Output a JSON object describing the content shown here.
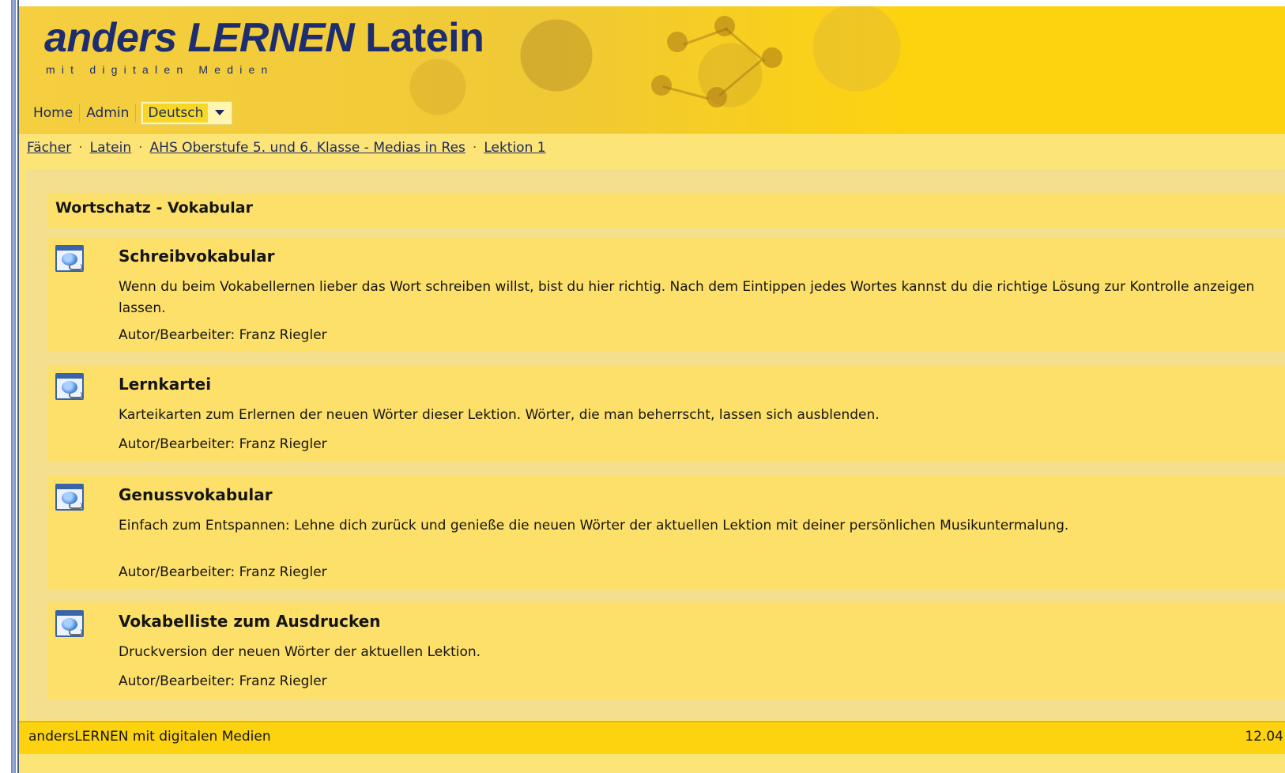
{
  "header": {
    "logo_part1": "anders",
    "logo_part2": "LERNEN",
    "logo_part3": "Latein",
    "subtitle": "mit digitalen Medien"
  },
  "nav": {
    "home": "Home",
    "admin": "Admin",
    "language": "Deutsch"
  },
  "breadcrumb": [
    "Fächer",
    "Latein",
    "AHS Oberstufe 5. und 6. Klasse - Medias in Res",
    "Lektion 1"
  ],
  "breadcrumb_separator": "·",
  "section": {
    "title": "Wortschatz - Vokabular"
  },
  "items": [
    {
      "title": "Schreibvokabular",
      "desc": "Wenn du beim Vokabellernen lieber das Wort schreiben willst, bist du hier richtig. Nach dem Eintippen jedes Wortes kannst du die richtige Lösung zur Kontrolle anzeigen lassen.",
      "author": "Autor/Bearbeiter: Franz Riegler"
    },
    {
      "title": "Lernkartei",
      "desc": "Karteikarten zum Erlernen der neuen Wörter dieser Lektion. Wörter, die man beherrscht, lassen sich ausblenden.",
      "author": "Autor/Bearbeiter: Franz Riegler"
    },
    {
      "title": "Genussvokabular",
      "desc": "Einfach zum Entspannen: Lehne dich zurück und genieße die neuen Wörter der aktuellen Lektion mit deiner persönlichen Musikuntermalung.",
      "author": "Autor/Bearbeiter: Franz Riegler"
    },
    {
      "title": "Vokabelliste zum Ausdrucken",
      "desc": "Druckversion der neuen Wörter der aktuellen Lektion.",
      "author": "Autor/Bearbeiter: Franz Riegler"
    }
  ],
  "footer": {
    "left": "andersLERNEN mit digitalen Medien",
    "right": "12.04"
  },
  "icons": {
    "item_icon": "web-module-globe-icon",
    "dropdown_icon": "chevron-down-icon"
  },
  "colors": {
    "header_yellow": "#fdd30f",
    "panel_yellow": "#fde069",
    "logo_blue": "#1e2d6e"
  }
}
